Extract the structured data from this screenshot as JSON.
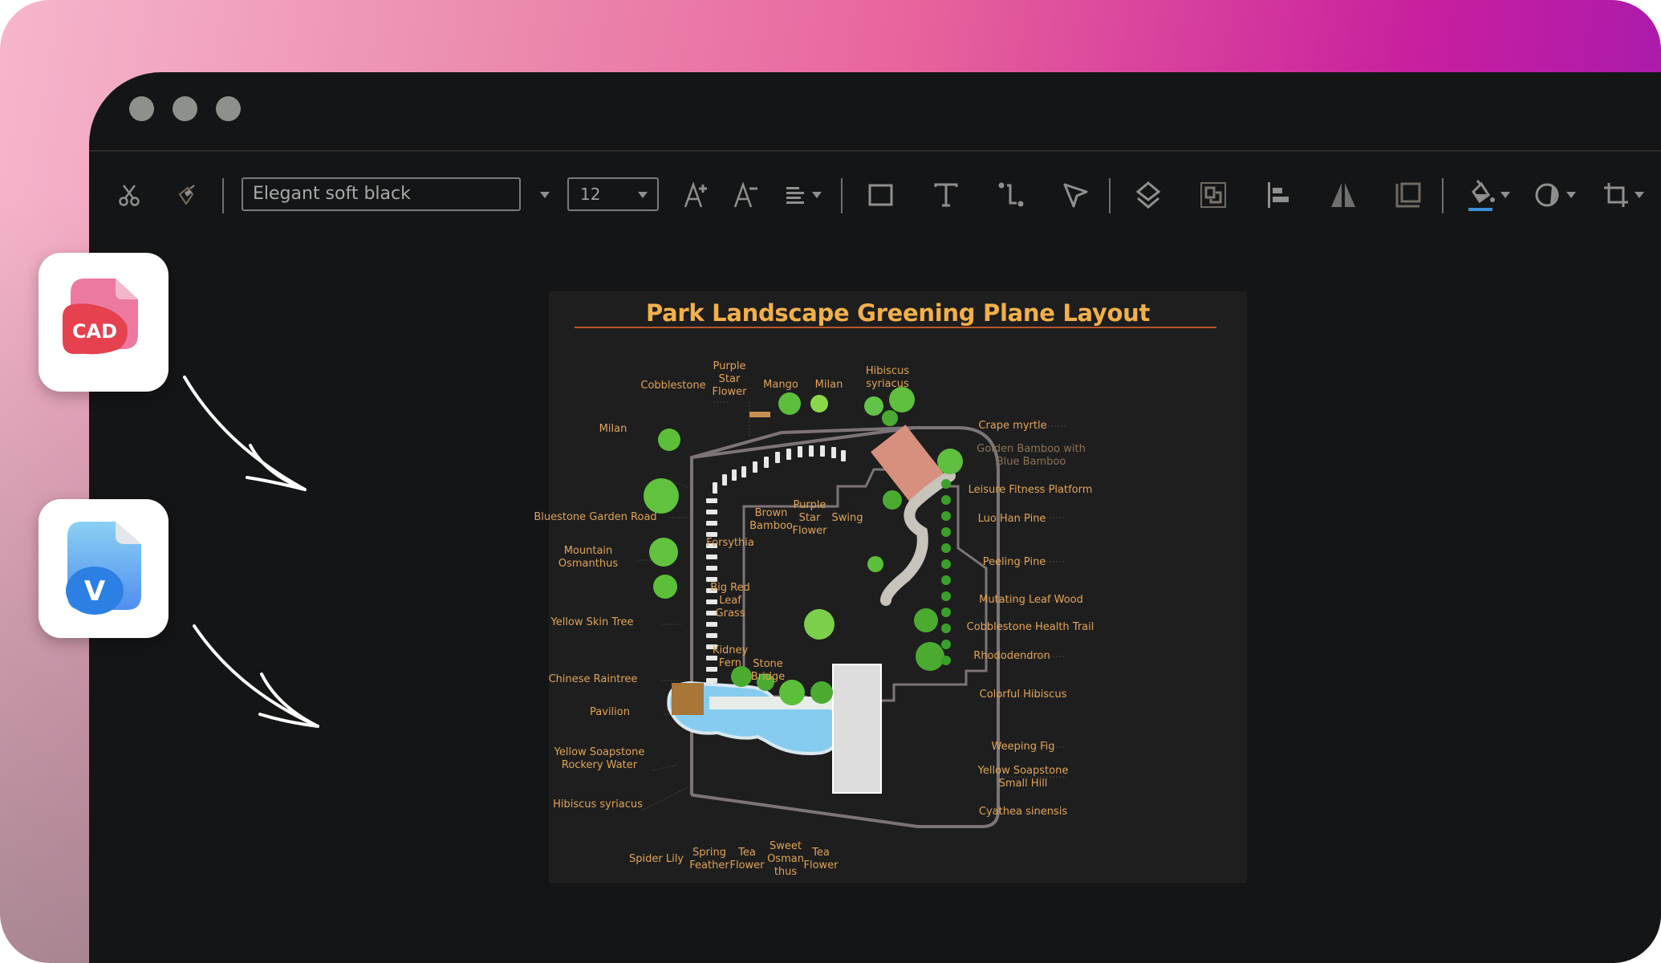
{
  "window": {
    "traffic_lights": [
      "close",
      "minimize",
      "maximize"
    ]
  },
  "toolbar": {
    "cut_icon": "scissors-icon",
    "format_painter_icon": "brush-icon",
    "font_family": "Elegant soft black",
    "font_size": "12",
    "buttons": [
      {
        "name": "increase-font-size",
        "icon": "A+"
      },
      {
        "name": "decrease-font-size",
        "icon": "A-"
      },
      {
        "name": "text-align",
        "icon": "align-left"
      },
      {
        "name": "rectangle-tool",
        "icon": "square"
      },
      {
        "name": "text-tool",
        "icon": "T"
      },
      {
        "name": "connector-tool",
        "icon": "connector"
      },
      {
        "name": "pointer-tool",
        "icon": "cursor"
      },
      {
        "name": "layers",
        "icon": "layers"
      },
      {
        "name": "group",
        "icon": "group"
      },
      {
        "name": "align",
        "icon": "align-objects"
      },
      {
        "name": "flip",
        "icon": "flip"
      },
      {
        "name": "bring-to-front",
        "icon": "arrange"
      },
      {
        "name": "fill-color",
        "icon": "paint-bucket"
      },
      {
        "name": "shape-style",
        "icon": "circle"
      },
      {
        "name": "crop",
        "icon": "crop"
      }
    ],
    "fill_color_swatch": "#3a8fd6"
  },
  "import_cards": [
    {
      "label": "CAD",
      "color": "#e5414f"
    },
    {
      "label": "V",
      "color": "#2c80e4"
    }
  ],
  "diagram": {
    "title": "Park Landscape Greening Plane Layout",
    "title_color": "#f2b04a",
    "labels": {
      "cobblestone": "Cobblestone",
      "purple_star_flower_top": "Purple\nStar\nFlower",
      "mango": "Mango",
      "milan_top": "Milan",
      "hibiscus_syriacus_top": "Hibiscus\nsyriacus",
      "milan_left": "Milan",
      "bluestone_garden_road": "Bluestone Garden Road",
      "mountain_osmanthus": "Mountain\nOsmanthus",
      "yellow_skin_tree": "Yellow Skin Tree",
      "chinese_raintree": "Chinese Raintree",
      "pavilion": "Pavilion",
      "yellow_soapstone_rockery_water": "Yellow Soapstone\nRockery Water",
      "hibiscus_syriacus_bottom": "Hibiscus syriacus",
      "spider_lily": "Spider Lily",
      "spring_feather": "Spring\nFeather",
      "tea_flower_1": "Tea\nFlower",
      "sweet_osmanthus": "Sweet\nOsman\nthus",
      "tea_flower_2": "Tea\nFlower",
      "brown_bamboo": "Brown\nBamboo",
      "purple_star_flower_inner": "Purple\nStar\nFlower",
      "swing": "Swing",
      "forsythia": "Forsythia",
      "big_red_leaf_grass": "Big Red\nLeaf\nGrass",
      "kidney_fern": "Kidney\nFern",
      "stone_bridge": "Stone\nBridge",
      "crape_myrtle": "Crape myrtle",
      "golden_bamboo": "Golden Bamboo with\nBlue Bamboo",
      "leisure_fitness_platform": "Leisure Fitness Platform",
      "luo_han_pine": "Luo Han Pine",
      "peeling_pine": "Peeling Pine",
      "mutating_leaf_wood": "Mutating Leaf Wood",
      "cobblestone_health_trail": "Cobblestone Health Trail",
      "rhododendron": "Rhododendron",
      "colorful_hibiscus": "Colorful Hibiscus",
      "weeping_fig": "Weeping Fig",
      "yellow_soapstone_small_hill": "Yellow Soapstone\nSmall Hill",
      "cyathea_sinensis": "Cyathea sinensis"
    }
  }
}
